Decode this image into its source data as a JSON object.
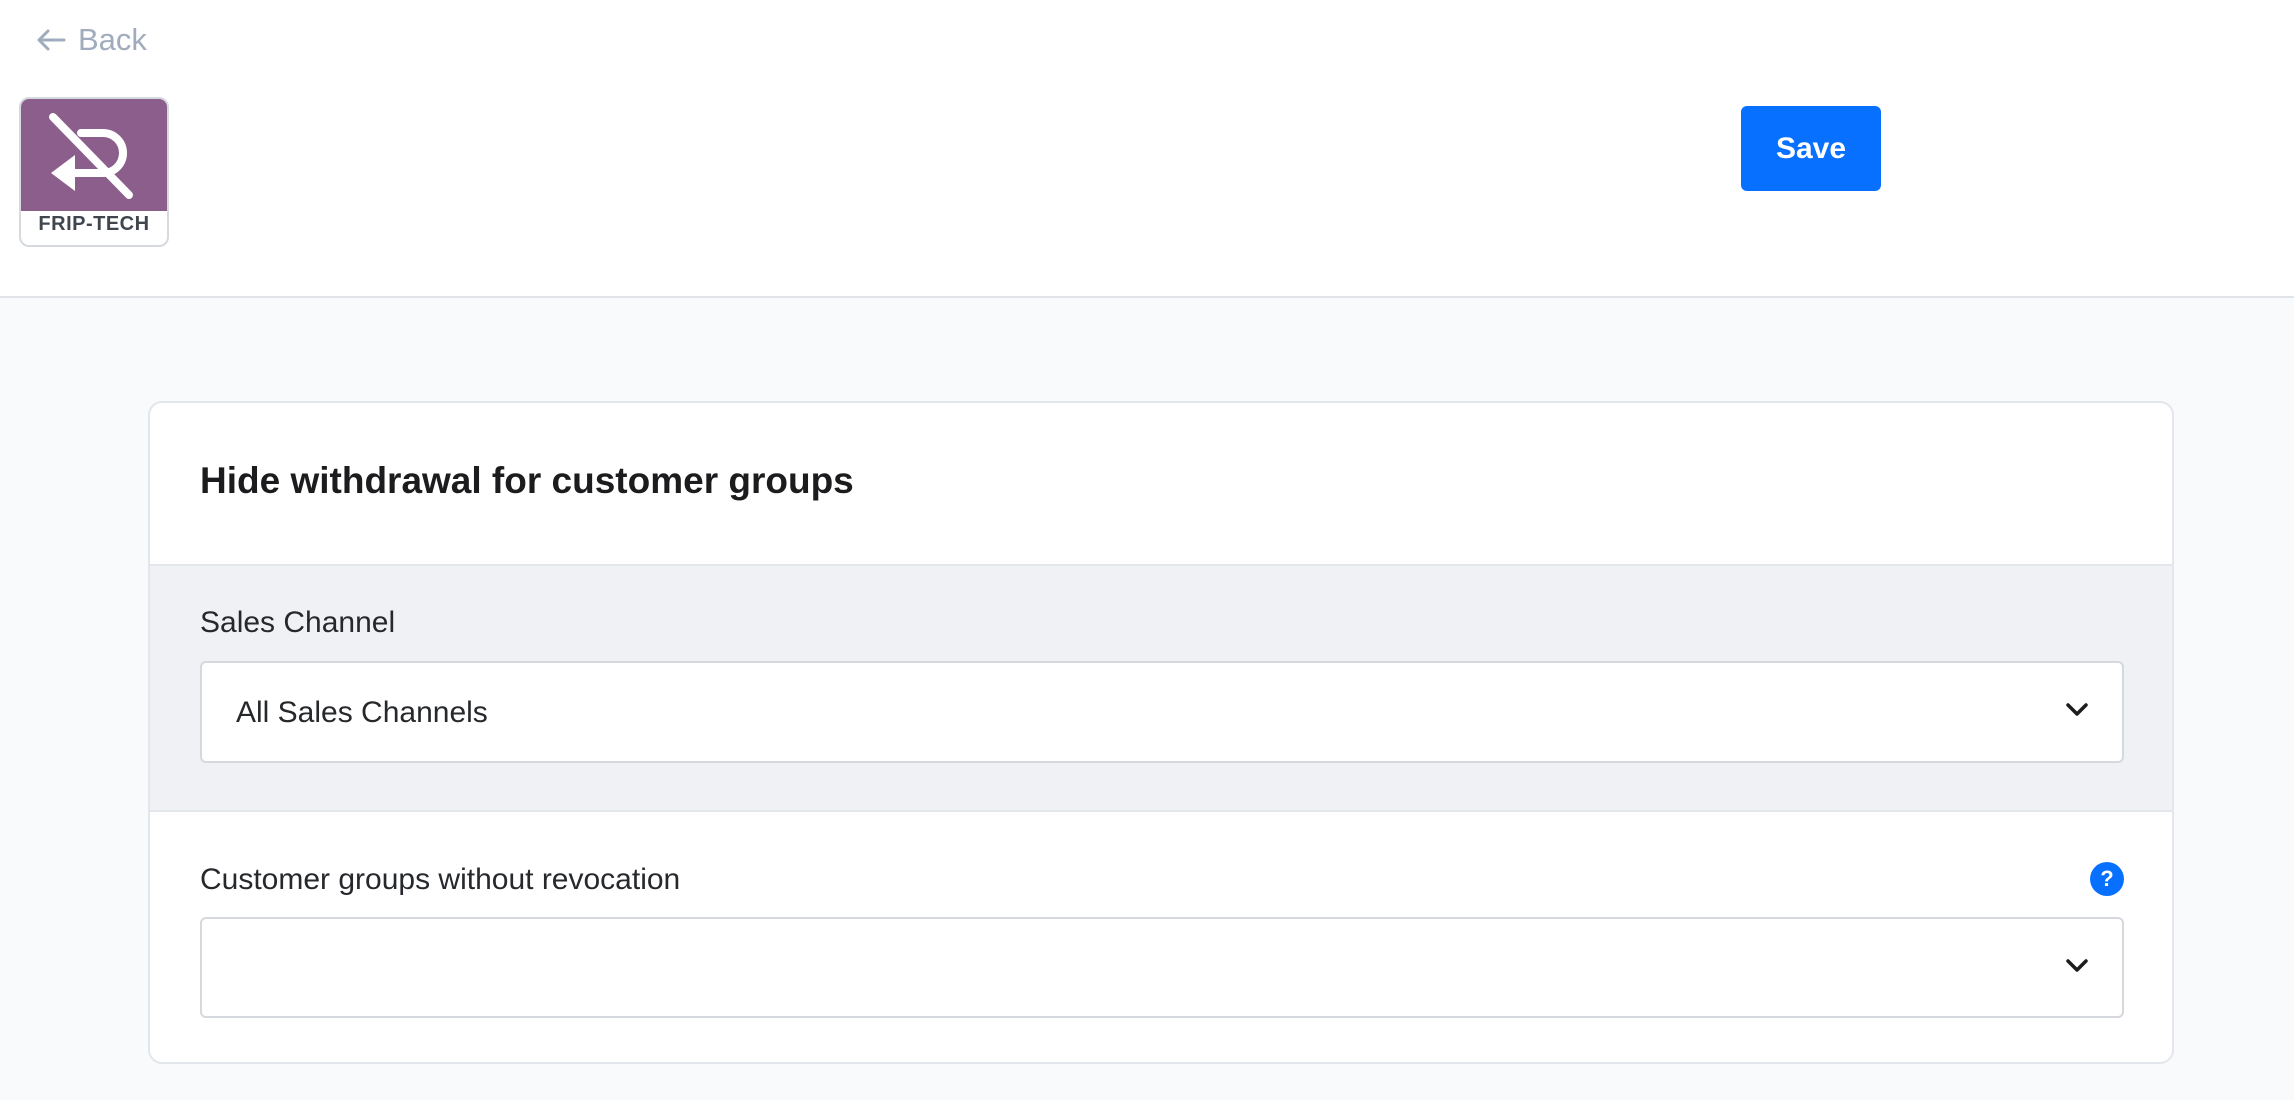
{
  "header": {
    "back_label": "Back",
    "logo_text": "FRIP-TECH",
    "save_label": "Save"
  },
  "card": {
    "title": "Hide withdrawal for customer groups",
    "sales_channel": {
      "label": "Sales Channel",
      "selected": "All Sales Channels"
    },
    "customer_groups": {
      "label": "Customer groups without revocation",
      "selected": "",
      "help_glyph": "?"
    }
  },
  "colors": {
    "primary": "#0870ff",
    "logo_purple": "#8c5e8c",
    "back_link": "#a0acbd"
  },
  "icons": {
    "back": "arrow-left-icon",
    "dropdown": "chevron-down-icon",
    "help": "question-circle-icon"
  }
}
